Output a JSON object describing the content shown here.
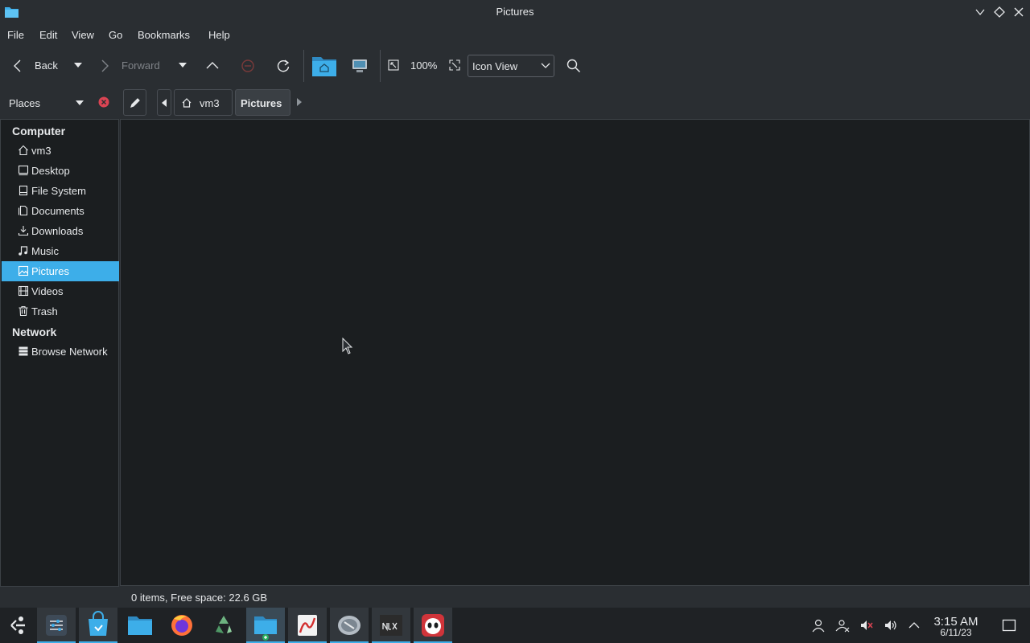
{
  "window": {
    "title": "Pictures"
  },
  "menubar": {
    "items": [
      "File",
      "Edit",
      "View",
      "Go",
      "Bookmarks",
      "Help"
    ]
  },
  "toolbar": {
    "back_label": "Back",
    "forward_label": "Forward",
    "zoom_level": "100%",
    "view_mode": "Icon View"
  },
  "places": {
    "title": "Places"
  },
  "breadcrumb": {
    "items": [
      "vm3",
      "Pictures"
    ]
  },
  "sidebar": {
    "sections": [
      {
        "header": "Computer",
        "items": [
          {
            "label": "vm3",
            "icon": "home-icon"
          },
          {
            "label": "Desktop",
            "icon": "desktop-icon"
          },
          {
            "label": "File System",
            "icon": "drive-icon"
          },
          {
            "label": "Documents",
            "icon": "documents-icon"
          },
          {
            "label": "Downloads",
            "icon": "download-icon"
          },
          {
            "label": "Music",
            "icon": "music-icon"
          },
          {
            "label": "Pictures",
            "icon": "image-icon",
            "selected": true
          },
          {
            "label": "Videos",
            "icon": "video-icon"
          },
          {
            "label": "Trash",
            "icon": "trash-icon"
          }
        ]
      },
      {
        "header": "Network",
        "items": [
          {
            "label": "Browse Network",
            "icon": "network-icon"
          }
        ]
      }
    ]
  },
  "status": {
    "text": "0 items, Free space: 22.6 GB"
  },
  "clock": {
    "time": "3:15 AM",
    "date": "6/11/23"
  },
  "colors": {
    "accent": "#3daee9",
    "window_bg": "#2a2e32",
    "view_bg": "#1b1e20"
  }
}
